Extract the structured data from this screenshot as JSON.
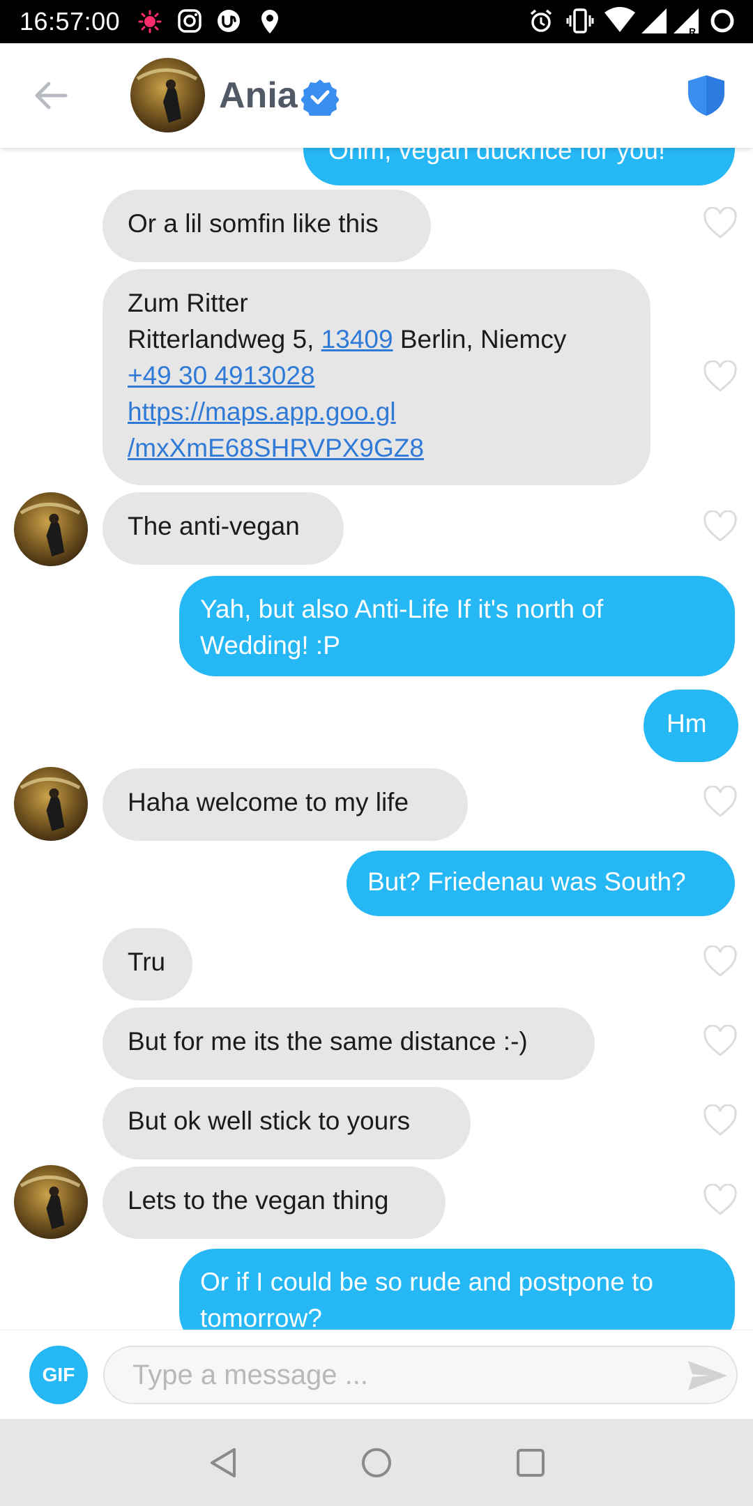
{
  "status_bar": {
    "time": "16:57:00",
    "icons": [
      "record-dot-icon",
      "instagram-icon",
      "app-u-icon",
      "location-pin-icon",
      "alarm-icon",
      "vibrate-icon",
      "wifi-icon",
      "signal-icon",
      "signal-roaming-icon",
      "battery-ring-icon"
    ]
  },
  "header": {
    "back_icon": "back-arrow-icon",
    "contact_name": "Ania",
    "verified_icon": "verified-badge-icon",
    "safety_icon": "shield-icon",
    "accent_color": "#3a8ef0"
  },
  "messages": [
    {
      "from": "me",
      "text": "Ohm, vegan duckrice for you!"
    },
    {
      "from": "them",
      "text": "Or a lil somfin like this"
    },
    {
      "from": "them",
      "place_name": "Zum Ritter",
      "address_prefix": "Ritterlandweg 5, ",
      "postal_code": "13409",
      "address_suffix": " Berlin, Niemcy",
      "phone": "+49 30 4913028",
      "url_line1": "https://maps.app.goo.gl",
      "url_line2": "/mxXmE68SHRVPX9GZ8"
    },
    {
      "from": "them",
      "text": "The anti-vegan"
    },
    {
      "from": "me",
      "line1": "Yah, but also Anti-Life If it's north of",
      "line2": "Wedding! :P"
    },
    {
      "from": "me",
      "text": "Hm"
    },
    {
      "from": "them",
      "text": "Haha welcome to my life"
    },
    {
      "from": "me",
      "text": "But? Friedenau was South?"
    },
    {
      "from": "them",
      "text": "Tru"
    },
    {
      "from": "them",
      "text": "But for me its the same distance :-)"
    },
    {
      "from": "them",
      "text": "But ok well stick to yours"
    },
    {
      "from": "them",
      "text": "Lets to the vegan thing"
    },
    {
      "from": "me",
      "line1": "Or if I could be so rude and postpone to",
      "line2": "tomorrow?"
    }
  ],
  "composer": {
    "gif_label": "GIF",
    "placeholder": "Type a message ...",
    "send_icon": "send-icon"
  },
  "nav_bar": {
    "icons": [
      "nav-back-icon",
      "nav-home-icon",
      "nav-recents-icon"
    ]
  },
  "colors": {
    "outgoing_bubble": "#26b7f5",
    "incoming_bubble": "#e6e6e6",
    "link": "#2f7ad6"
  }
}
